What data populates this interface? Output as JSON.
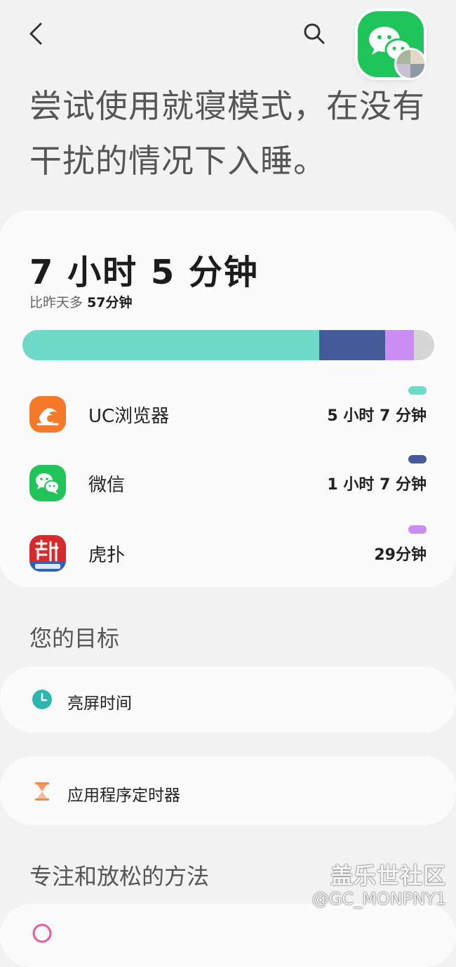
{
  "header": {
    "back_icon": "chevron-left-icon",
    "search_icon": "search-icon",
    "floating_app_icon": "wechat-icon"
  },
  "headline": "尝试使用就寝模式，在没有干扰的情况下入睡。",
  "usage": {
    "total_time": "7 小时 5 分钟",
    "compare_prefix": "比昨天多",
    "compare_value": "57分钟",
    "bar": {
      "segments": [
        {
          "app": "UC浏览器",
          "fraction": 0.72,
          "color": "#6dd9c6"
        },
        {
          "app": "微信",
          "fraction": 0.16,
          "color": "#455a98"
        },
        {
          "app": "虎扑",
          "fraction": 0.07,
          "color": "#c98df4"
        },
        {
          "app": "其他",
          "fraction": 0.05,
          "color": "#d6d6d6"
        }
      ]
    },
    "apps": [
      {
        "name": "UC浏览器",
        "time": "5 小时 7 分钟",
        "color": "#6dd9c6",
        "icon": "uc-browser-icon"
      },
      {
        "name": "微信",
        "time": "1 小时 7 分钟",
        "color": "#455a98",
        "icon": "wechat-icon"
      },
      {
        "name": "虎扑",
        "time": "29分钟",
        "color": "#c98df4",
        "icon": "hupu-icon"
      }
    ]
  },
  "goals": {
    "title": "您的目标",
    "items": [
      {
        "label": "亮屏时间",
        "icon": "clock-icon",
        "icon_color": "#2bb7b0"
      },
      {
        "label": "应用程序定时器",
        "icon": "hourglass-icon",
        "icon_color": "#f2884c"
      }
    ]
  },
  "relax": {
    "title": "专注和放松的方法"
  },
  "watermark": {
    "brand": "盖乐世社区",
    "user": "@GC_MONPNY1"
  }
}
